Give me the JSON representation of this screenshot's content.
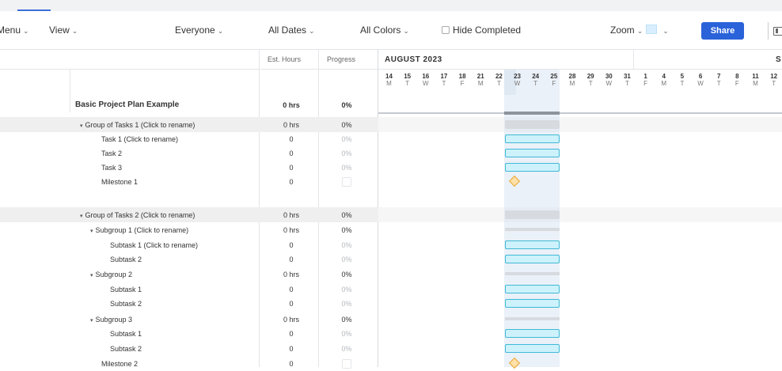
{
  "toolbar": {
    "menu": "Menu",
    "view": "View",
    "everyone": "Everyone",
    "all_dates": "All Dates",
    "all_colors": "All Colors",
    "hide_completed": "Hide Completed",
    "zoom": "Zoom",
    "share": "Share"
  },
  "columns": {
    "est_hours": "Est. Hours",
    "progress": "Progress"
  },
  "timeline": {
    "month": "AUGUST 2023",
    "next_month_initial": "S",
    "days": [
      {
        "n": "14",
        "l": "M"
      },
      {
        "n": "15",
        "l": "T"
      },
      {
        "n": "16",
        "l": "W"
      },
      {
        "n": "17",
        "l": "T"
      },
      {
        "n": "18",
        "l": "F"
      },
      {
        "n": "21",
        "l": "M"
      },
      {
        "n": "22",
        "l": "T"
      },
      {
        "n": "23",
        "l": "W"
      },
      {
        "n": "24",
        "l": "T"
      },
      {
        "n": "25",
        "l": "F"
      },
      {
        "n": "28",
        "l": "M"
      },
      {
        "n": "29",
        "l": "T"
      },
      {
        "n": "30",
        "l": "W"
      },
      {
        "n": "31",
        "l": "T"
      },
      {
        "n": "1",
        "l": "F"
      },
      {
        "n": "4",
        "l": "M"
      },
      {
        "n": "5",
        "l": "T"
      },
      {
        "n": "6",
        "l": "W"
      },
      {
        "n": "7",
        "l": "T"
      },
      {
        "n": "8",
        "l": "F"
      },
      {
        "n": "11",
        "l": "M"
      },
      {
        "n": "12",
        "l": "T"
      }
    ]
  },
  "project": {
    "title": "Basic Project Plan Example",
    "title_hours": "0 hrs",
    "title_progress": "0%",
    "rows": [
      {
        "name": "Group of Tasks 1 (Click to rename)",
        "est": "0 hrs",
        "prog": "0%",
        "type": "group"
      },
      {
        "name": "Task 1 (Click to rename)",
        "est": "0",
        "prog": "0%",
        "type": "task"
      },
      {
        "name": "Task 2",
        "est": "0",
        "prog": "0%",
        "type": "task"
      },
      {
        "name": "Task 3",
        "est": "0",
        "prog": "0%",
        "type": "task"
      },
      {
        "name": "Milestone 1",
        "est": "0",
        "prog": "",
        "type": "milestone"
      },
      {
        "name": "Group of Tasks 2 (Click to rename)",
        "est": "0 hrs",
        "prog": "0%",
        "type": "group"
      },
      {
        "name": "Subgroup 1 (Click to rename)",
        "est": "0 hrs",
        "prog": "0%",
        "type": "subgroup"
      },
      {
        "name": "Subtask 1 (Click to rename)",
        "est": "0",
        "prog": "0%",
        "type": "subtask"
      },
      {
        "name": "Subtask 2",
        "est": "0",
        "prog": "0%",
        "type": "subtask"
      },
      {
        "name": "Subgroup 2",
        "est": "0 hrs",
        "prog": "0%",
        "type": "subgroup"
      },
      {
        "name": "Subtask 1",
        "est": "0",
        "prog": "0%",
        "type": "subtask"
      },
      {
        "name": "Subtask 2",
        "est": "0",
        "prog": "0%",
        "type": "subtask"
      },
      {
        "name": "Subgroup 3",
        "est": "0 hrs",
        "prog": "0%",
        "type": "subgroup"
      },
      {
        "name": "Subtask 1",
        "est": "0",
        "prog": "0%",
        "type": "subtask"
      },
      {
        "name": "Subtask 2",
        "est": "0",
        "prog": "0%",
        "type": "subtask"
      },
      {
        "name": "Milestone 2",
        "est": "0",
        "prog": "",
        "type": "milestone"
      }
    ]
  },
  "colors": {
    "accent": "#2a62d9",
    "task_fill": "#cdf2fb",
    "task_border": "#3fb9d6",
    "milestone": "#ffe0a6"
  }
}
